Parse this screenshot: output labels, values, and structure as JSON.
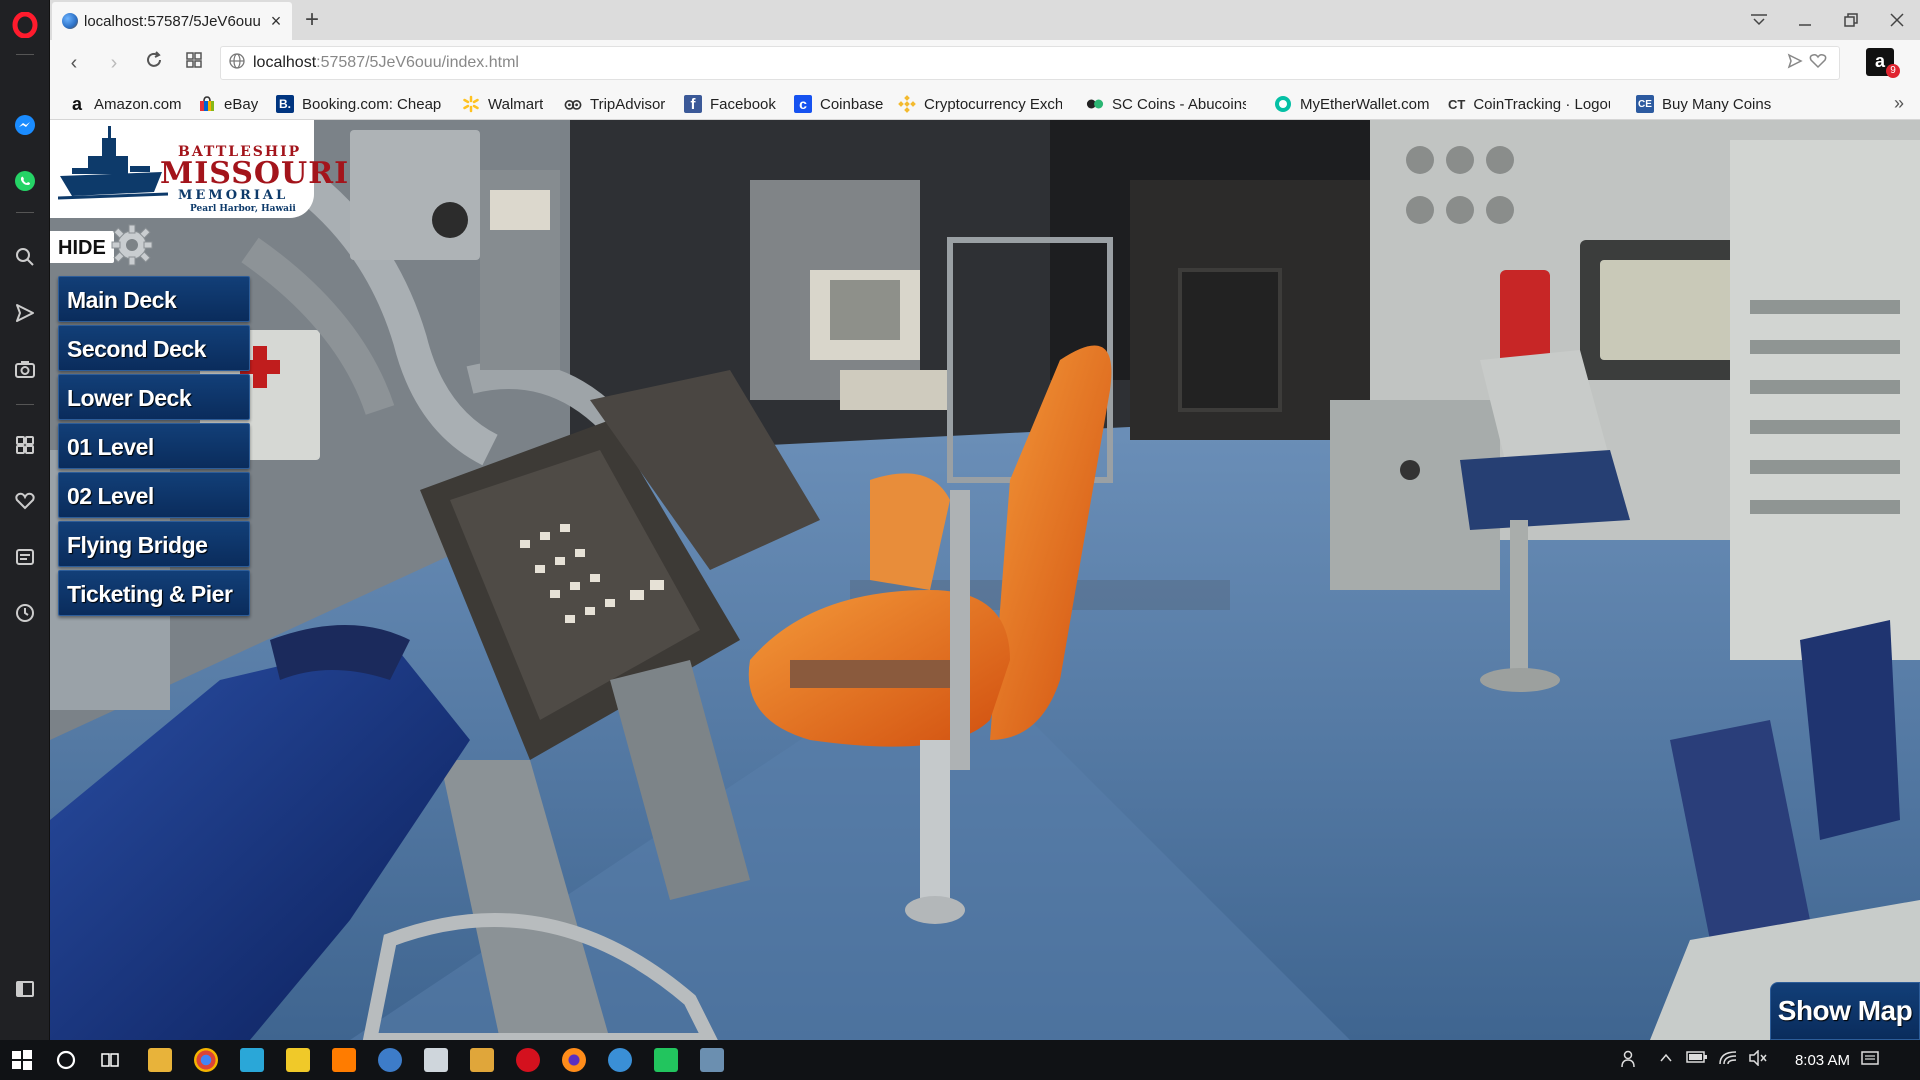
{
  "browser": {
    "tab_title": "localhost:57587/5JeV6ouu",
    "new_tab": "+",
    "url_host": "localhost",
    "url_rest": ":57587/5JeV6ouu/index.html",
    "extension_badge": "9",
    "bookmarks": [
      {
        "label": "Amazon.com",
        "icon": "amazon-icon"
      },
      {
        "label": "eBay",
        "icon": "ebay-icon"
      },
      {
        "label": "Booking.com: Cheap",
        "icon": "booking-icon"
      },
      {
        "label": "Walmart",
        "icon": "walmart-icon"
      },
      {
        "label": "TripAdvisor",
        "icon": "tripadvisor-icon"
      },
      {
        "label": "Facebook",
        "icon": "facebook-icon"
      },
      {
        "label": "Coinbase",
        "icon": "coinbase-icon"
      },
      {
        "label": "Cryptocurrency Excha",
        "icon": "binance-icon"
      },
      {
        "label": "SC Coins - Abucoins.c",
        "icon": "abucoins-icon"
      },
      {
        "label": "MyEtherWallet.com",
        "icon": "myetherwallet-icon"
      },
      {
        "label": "CoinTracking · Logou",
        "icon": "cointracking-icon"
      },
      {
        "label": "Buy Many Coins",
        "icon": "buymanycoins-icon"
      }
    ],
    "bookmark_icon_text": {
      "booking": "B.",
      "facebook": "f",
      "coinbase": "c",
      "cointracking": "CT",
      "buymanycoins": "CE",
      "amazon": "a"
    }
  },
  "tour": {
    "logo": {
      "line1": "BATTLESHIP",
      "line2": "MISSOURI",
      "line3": "MEMORIAL",
      "line4": "Pearl Harbor, Hawaii"
    },
    "hide_label": "HIDE",
    "decks": [
      "Main Deck",
      "Second Deck",
      "Lower Deck",
      "01 Level",
      "02 Level",
      "Flying Bridge",
      "Ticketing & Pier"
    ],
    "show_map_label": "Show Map"
  },
  "taskbar": {
    "time": "8:03 AM"
  },
  "colors": {
    "menu_blue": "#0d3468",
    "logo_red": "#a3141b",
    "chair_orange": "#e8651a",
    "floor_blue": "#4d6f96"
  }
}
